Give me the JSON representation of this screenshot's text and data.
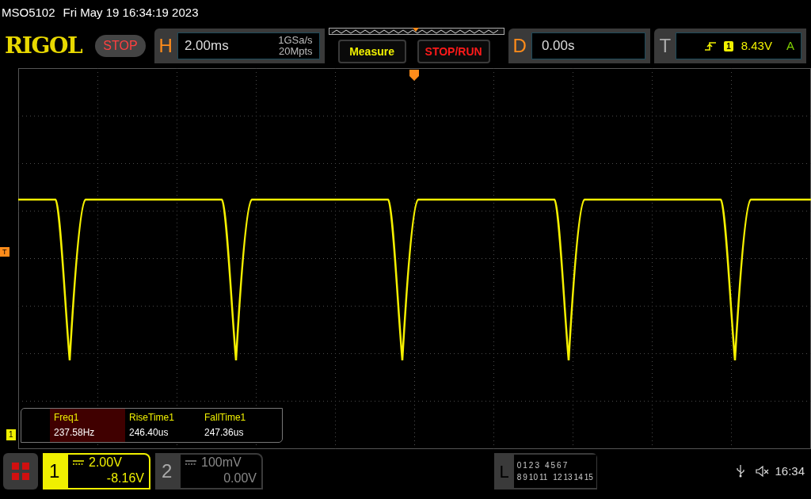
{
  "status_line": {
    "model": "MSO5102",
    "datetime": "Fri May 19 16:34:19 2023"
  },
  "toolbar": {
    "logo": "RIGOL",
    "run_state": "STOP",
    "horizontal": {
      "label": "H",
      "timebase": "2.00ms",
      "sample_rate": "1GSa/s",
      "memory_depth": "20Mpts"
    },
    "buttons": [
      {
        "label": "Measure",
        "kind": "menu"
      },
      {
        "label": "STOP/RUN",
        "kind": "run"
      }
    ],
    "delay": {
      "label": "D",
      "value": "0.00s"
    },
    "trigger": {
      "label": "T",
      "source": "1",
      "level": "8.43V",
      "mode": "A"
    }
  },
  "display": {
    "trigger_level_marker": "T",
    "channel_marker": "1",
    "measurements": [
      {
        "name": "Freq1",
        "value": "237.58Hz",
        "selected": true
      },
      {
        "name": "RiseTime1",
        "value": "246.40us",
        "selected": false
      },
      {
        "name": "FallTime1",
        "value": "247.36us",
        "selected": false
      }
    ]
  },
  "bottom_bar": {
    "channels": [
      {
        "number": "1",
        "scale": "2.00V",
        "offset": "-8.16V",
        "active": true
      },
      {
        "number": "2",
        "scale": "100mV",
        "offset": "0.00V",
        "active": false
      }
    ],
    "logic": {
      "label": "L",
      "row1": [
        "0",
        "1",
        "2",
        "3",
        "4",
        "5",
        "6",
        "7"
      ],
      "row2": [
        "8",
        "9",
        "10",
        "11",
        "12",
        "13",
        "14",
        "15"
      ]
    },
    "clock": "16:34"
  }
}
